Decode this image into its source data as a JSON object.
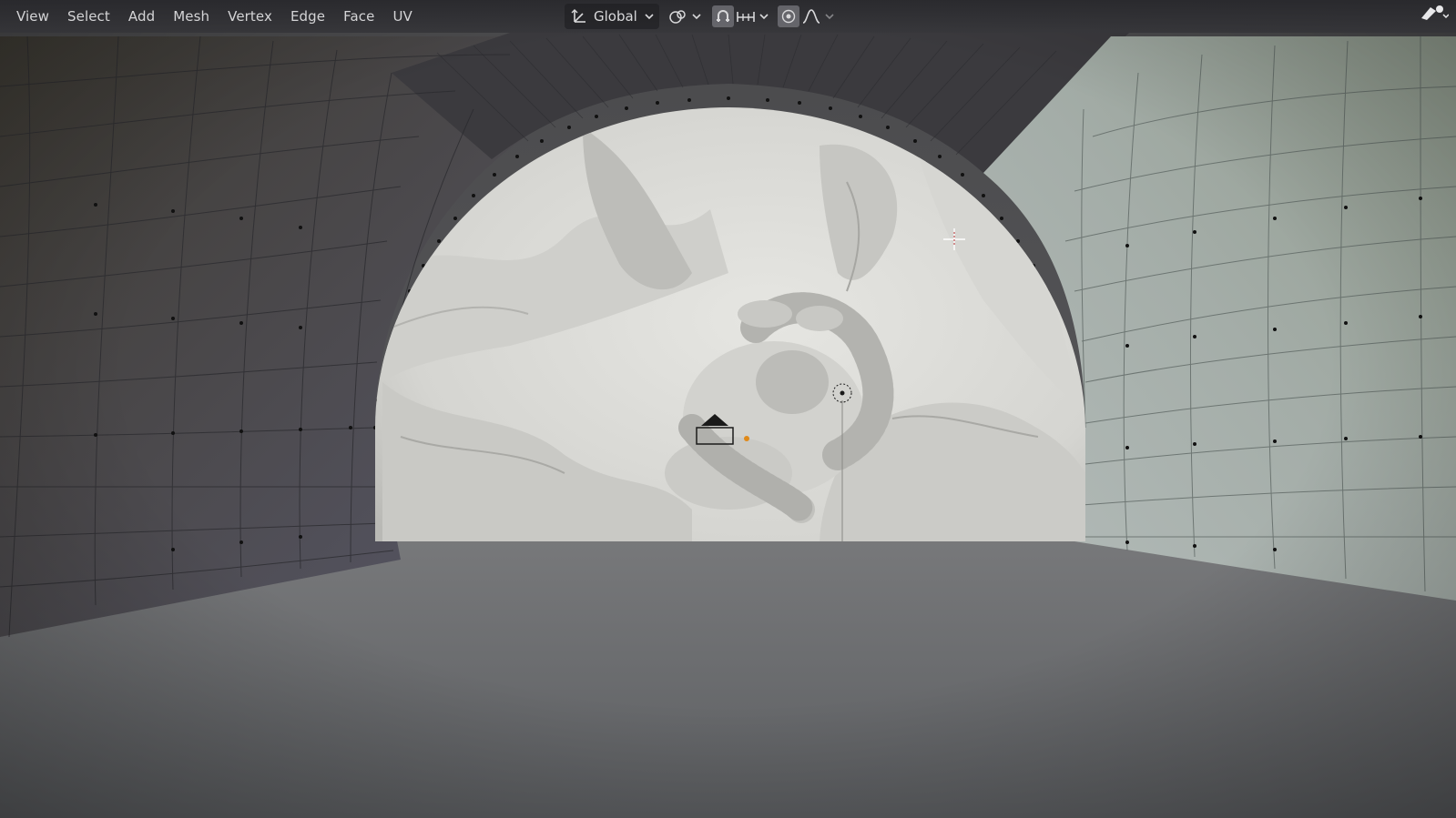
{
  "editor": {
    "mode": "Edit Mode",
    "menu": [
      {
        "id": "view",
        "label": "View"
      },
      {
        "id": "select",
        "label": "Select"
      },
      {
        "id": "add",
        "label": "Add"
      },
      {
        "id": "mesh",
        "label": "Mesh"
      },
      {
        "id": "vertex",
        "label": "Vertex"
      },
      {
        "id": "edge",
        "label": "Edge"
      },
      {
        "id": "face",
        "label": "Face"
      },
      {
        "id": "uv",
        "label": "UV"
      }
    ],
    "toolbar": {
      "transform_orientation": {
        "icon": "transform-orientation-icon",
        "value": "Global"
      },
      "pivot_point": {
        "icon": "pivot-point-icon"
      },
      "snap": {
        "icon": "snap-magnet-icon",
        "active": true
      },
      "snap_target": {
        "icon": "snap-increment-icon"
      },
      "proportional_editing": {
        "icon": "proportional-editing-icon",
        "active": true
      },
      "proportional_falloff": {
        "icon": "falloff-curve-icon"
      }
    },
    "viewport": {
      "content": "tunnel mesh with vertices around sculpted serpent and skull",
      "icons": [
        "3d-cursor-icon",
        "camera-object-icon",
        "light-object-icon"
      ]
    }
  },
  "colors": {
    "header_bg": "#2c2c30",
    "menu_text": "#d4d4d6",
    "active_button": "#6e6e74",
    "sculpt_clay": "#dcdcd8",
    "wall_left": "#4a4a52",
    "wall_right": "#9fa8a4",
    "floor": "#6e7072",
    "vertex_dot": "#111111",
    "origin_orange": "#e08a1a"
  }
}
